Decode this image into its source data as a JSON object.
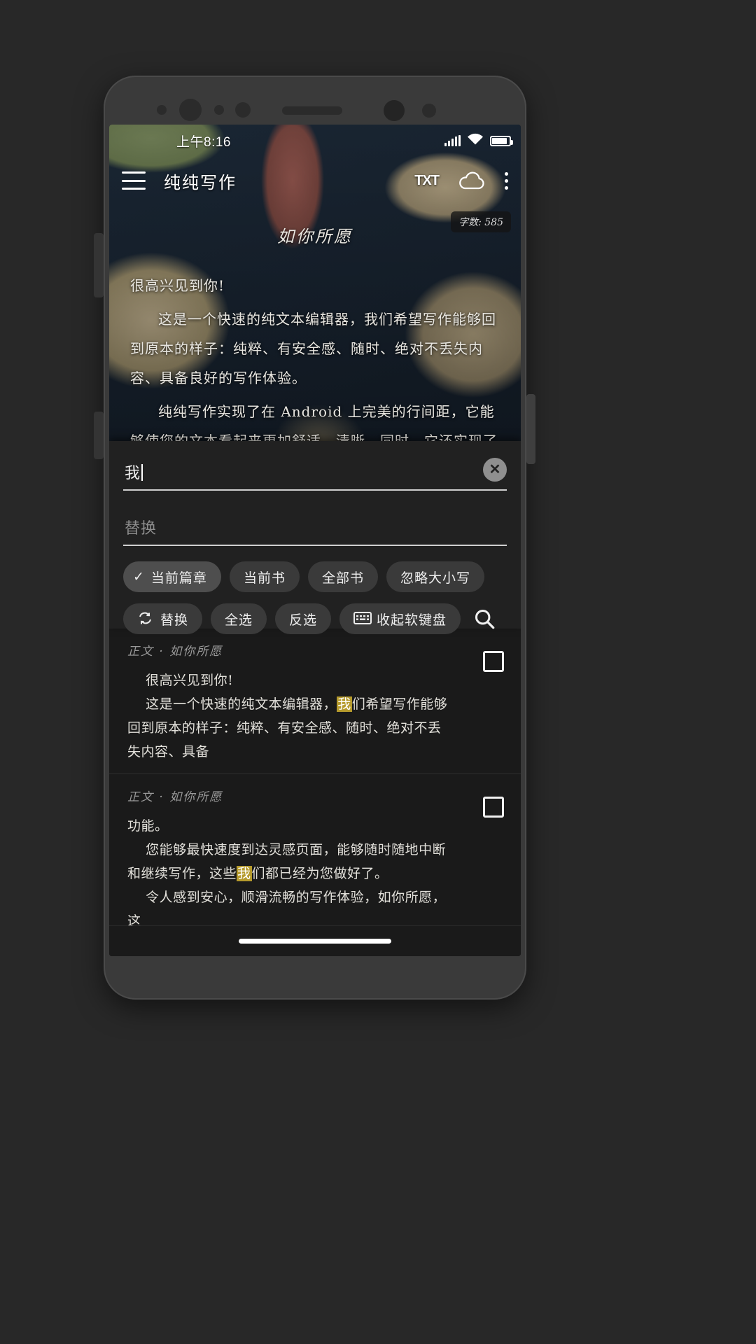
{
  "statusbar": {
    "time": "上午8:16"
  },
  "appbar": {
    "title": "纯纯写作",
    "menu_icon": "hamburger-menu-icon",
    "txt_label": "TXT",
    "cloud_icon": "cloud-icon",
    "overflow_icon": "more-vertical-icon"
  },
  "word_badge": "字数: 585",
  "document": {
    "heading": "如你所愿",
    "paragraphs": [
      "很高兴见到你!",
      "这是一个快速的纯文本编辑器，我们希望写作能够回到原本的样子：纯粹、有安全感、随时、绝对不丢失内容、具备良好的写作体验。",
      "纯纯写作实现了在 Android 上完美的行间距，它能够使您的文本看起来更加舒适、清晰。同时，它还实现了「快捷输入栏」和「格式化工具」，以及许"
    ]
  },
  "find_panel": {
    "search_value": "我",
    "search_placeholder": "",
    "clear_icon": "clear-circle-icon",
    "replace_value": "",
    "replace_placeholder": "替换",
    "scope_chips": [
      {
        "label": "当前篇章",
        "selected": true,
        "icon": "check-icon"
      },
      {
        "label": "当前书",
        "selected": false,
        "icon": ""
      },
      {
        "label": "全部书",
        "selected": false,
        "icon": ""
      },
      {
        "label": "忽略大小写",
        "selected": false,
        "icon": ""
      }
    ],
    "actions": [
      {
        "label": "替换",
        "icon": "replace-icon"
      },
      {
        "label": "全选",
        "icon": ""
      },
      {
        "label": "反选",
        "icon": ""
      },
      {
        "label": "收起软键盘",
        "icon": "keyboard-icon"
      }
    ],
    "search_button_icon": "search-icon"
  },
  "results": [
    {
      "source": "正文",
      "separator": "·",
      "chapter": "如你所愿",
      "before": "    很高兴见到你!\n    这是一个快速的纯文本编辑器，",
      "match": "我",
      "after": "们希望写作能够回到原本的样子：纯粹、有安全感、随时、绝对不丢失内容、具备",
      "checked": false
    },
    {
      "source": "正文",
      "separator": "·",
      "chapter": "如你所愿",
      "before": "功能。\n    您能够最快速度到达灵感页面，能够随时随地中断和继续写作，这些",
      "match": "我",
      "after": "们都已经为您做好了。\n    令人感到安心，顺滑流畅的写作体验，如你所愿，这",
      "checked": false
    }
  ],
  "navbar": {
    "pill": "home-indicator"
  },
  "colors": {
    "panel_bg": "#212121",
    "results_bg": "#1a1a1a",
    "highlight": "#b59a2c",
    "chip_bg": "#3a3a3a",
    "chip_selected_bg": "#4e4e4e"
  }
}
